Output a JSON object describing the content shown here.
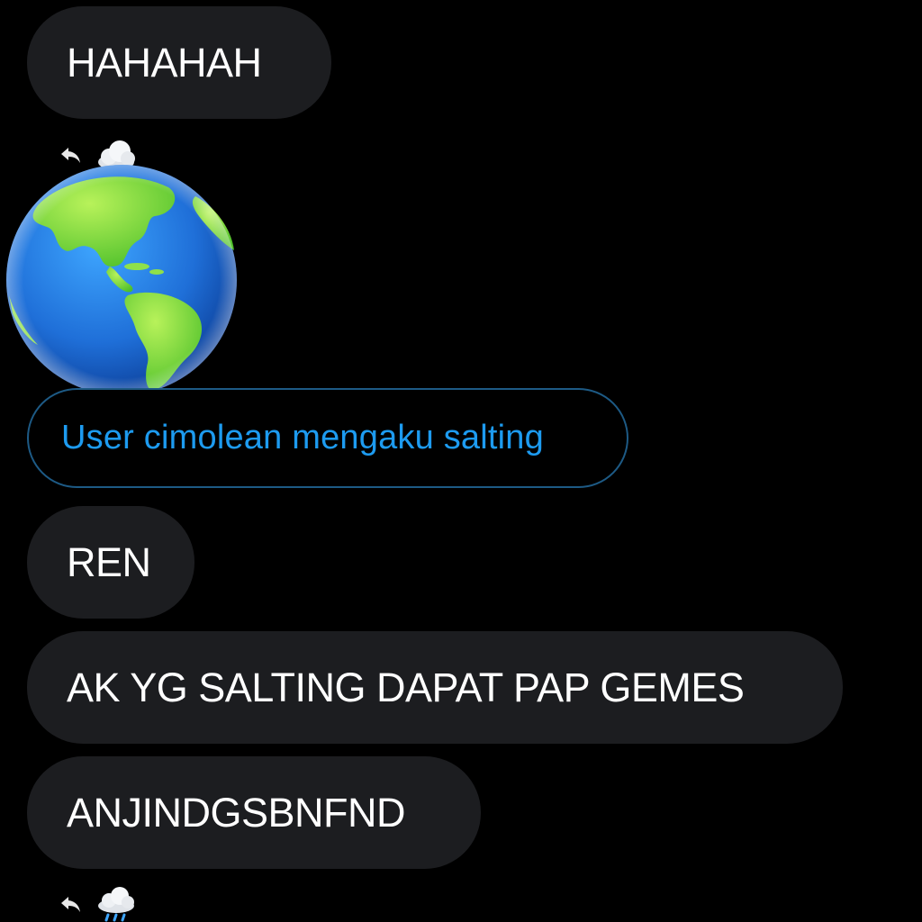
{
  "messages": [
    {
      "text": "HAHAHAH"
    },
    {
      "text": "REN"
    },
    {
      "text": "AK YG SALTING DAPAT PAP GEMES"
    },
    {
      "text": "ANJINDGSBNFND"
    }
  ],
  "quoted_message": {
    "text": "User cimolean mengaku salting"
  },
  "reactions": {
    "first": {
      "icon": "cloud-icon"
    },
    "second": {
      "icon": "cloud-with-rain-icon"
    }
  },
  "sticker": {
    "icon": "globe-americas-icon"
  },
  "colors": {
    "background": "#000000",
    "bubble": "#1c1d20",
    "link": "#1d9bf0",
    "quote_border": "#1d5a85"
  }
}
